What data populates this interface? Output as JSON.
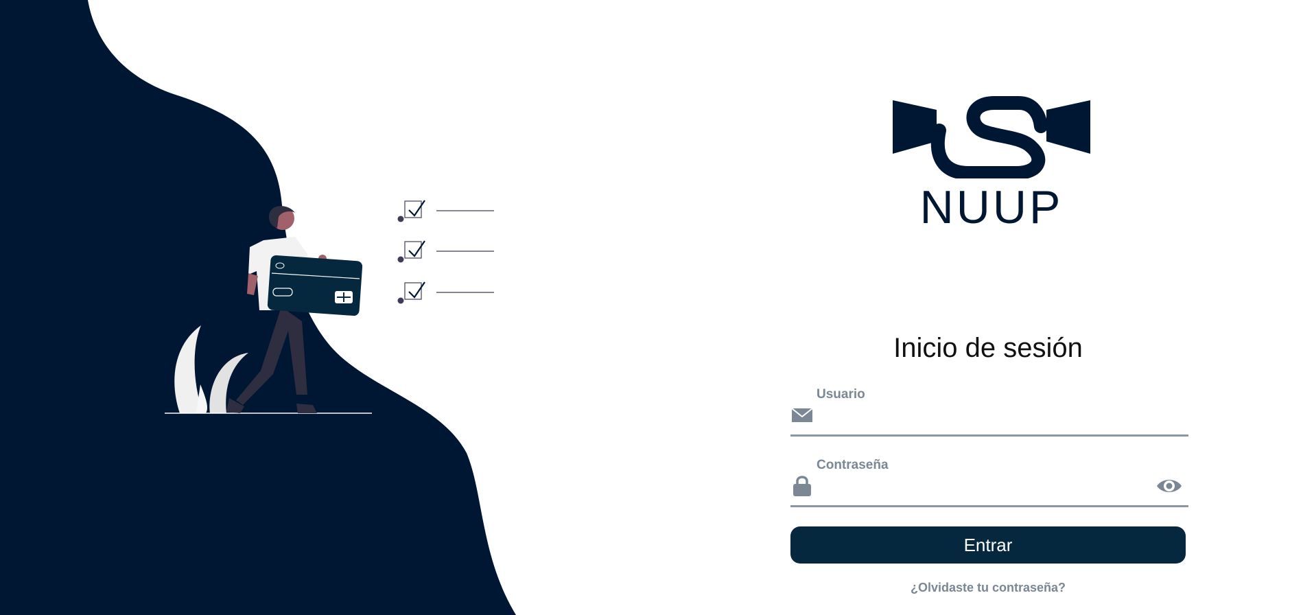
{
  "brand": {
    "name": "NUUP",
    "primary_color": "#001733"
  },
  "login": {
    "title": "Inicio de sesión",
    "username": {
      "label": "Usuario",
      "value": "",
      "icon": "envelope-icon"
    },
    "password": {
      "label": "Contraseña",
      "value": "",
      "icon": "lock-icon",
      "toggle_icon": "eye-icon"
    },
    "submit_label": "Entrar",
    "forgot_label": "¿Olvidaste tu contraseña?",
    "button_color": "#05283f"
  },
  "illustration": {
    "background_color": "#001733",
    "subject": "person-holding-credit-card",
    "checklist_items": 3
  }
}
